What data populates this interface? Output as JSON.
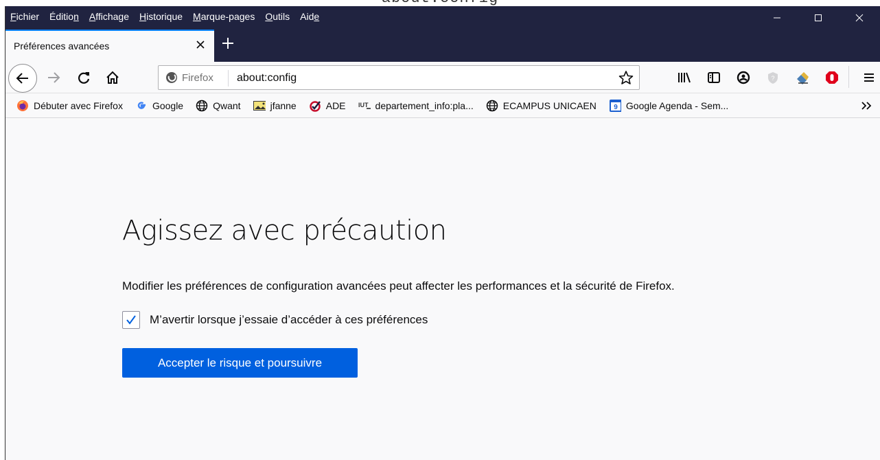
{
  "caption": "about:config",
  "menubar": {
    "items": [
      {
        "pre": "",
        "u": "F",
        "post": "ichier"
      },
      {
        "pre": "Éditio",
        "u": "n",
        "post": ""
      },
      {
        "pre": "",
        "u": "A",
        "post": "ffichage"
      },
      {
        "pre": "",
        "u": "H",
        "post": "istorique"
      },
      {
        "pre": "",
        "u": "M",
        "post": "arque-pages"
      },
      {
        "pre": "",
        "u": "O",
        "post": "utils"
      },
      {
        "pre": "Aid",
        "u": "e",
        "post": ""
      }
    ]
  },
  "tab": {
    "title": "Préférences avancées"
  },
  "urlbar": {
    "identity": "Firefox",
    "url": "about:config"
  },
  "bookmarks": [
    {
      "label": "Débuter avec Firefox",
      "icon": "firefox-icon"
    },
    {
      "label": "Google",
      "icon": "google-icon"
    },
    {
      "label": "Qwant",
      "icon": "globe-icon"
    },
    {
      "label": "jfanne",
      "icon": "image-icon"
    },
    {
      "label": "ADE",
      "icon": "ade-icon"
    },
    {
      "label": "departement_info:pla...",
      "icon": "iut-icon"
    },
    {
      "label": "ECAMPUS UNICAEN",
      "icon": "globe-icon"
    },
    {
      "label": "Google Agenda - Sem...",
      "icon": "calendar-icon",
      "badge": "9"
    }
  ],
  "warning": {
    "title": "Agissez avec précaution",
    "text": "Modifier les préférences de configuration avancées peut affecter les performances et la sécurité de Firefox.",
    "checkbox_label": "M’avertir lorsque j’essaie d’accéder à ces préférences",
    "checkbox_checked": true,
    "accept_label": "Accepter le risque et poursuivre"
  },
  "colors": {
    "chrome_dark": "#202340",
    "accent": "#0a84ff",
    "button_blue": "#0060df"
  }
}
